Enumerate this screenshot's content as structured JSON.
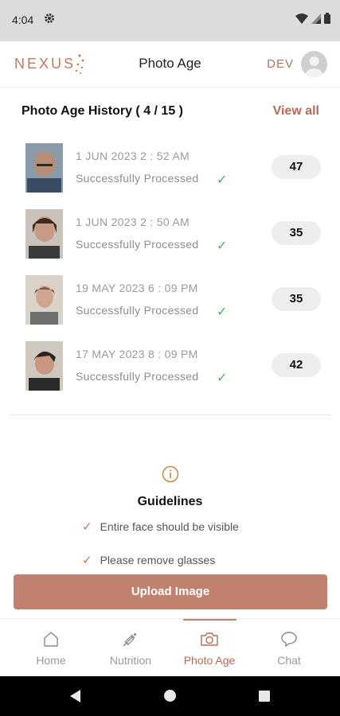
{
  "status_bar": {
    "time": "4:04"
  },
  "header": {
    "logo_text": "NEXUS",
    "title": "Photo Age",
    "env_label": "DEV"
  },
  "history": {
    "title": "Photo Age History ( 4 / 15 )",
    "view_all_label": "View all",
    "items": [
      {
        "date": "1 JUN 2023  2 : 52 AM",
        "status": "Successfully Processed",
        "age": "47"
      },
      {
        "date": "1 JUN 2023  2 : 50 AM",
        "status": "Successfully Processed",
        "age": "35"
      },
      {
        "date": "19 MAY 2023  6 : 09 PM",
        "status": "Successfully Processed",
        "age": "35"
      },
      {
        "date": "17 MAY 2023  8 : 09 PM",
        "status": "Successfully Processed",
        "age": "42"
      }
    ]
  },
  "guidelines": {
    "title": "Guidelines",
    "items": [
      "Entire face should be visible",
      "Please remove glasses"
    ]
  },
  "upload_button_label": "Upload Image",
  "bottom_nav": {
    "items": [
      {
        "label": "Home",
        "icon": "home-icon"
      },
      {
        "label": "Nutrition",
        "icon": "syringe-icon"
      },
      {
        "label": "Photo Age",
        "icon": "camera-icon",
        "active": true
      },
      {
        "label": "Chat",
        "icon": "chat-bubble-icon"
      }
    ]
  },
  "colors": {
    "accent": "#c0826f",
    "brand_text": "#b86a55",
    "success": "#44b35a",
    "status_bar": "#dcdcdc"
  }
}
